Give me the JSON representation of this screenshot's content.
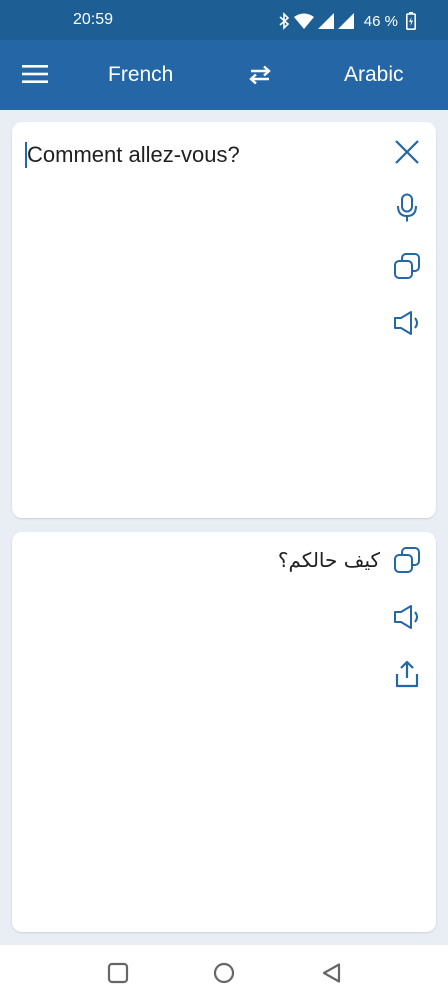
{
  "status_bar": {
    "time": "20:59",
    "battery": "46 %",
    "icons": [
      "bluetooth-icon",
      "wifi-icon",
      "signal-icon",
      "signal-icon",
      "battery-icon"
    ]
  },
  "app_bar": {
    "menu_icon": "menu-icon",
    "source_language": "French",
    "swap_icon": "swap-arrows-icon",
    "target_language": "Arabic"
  },
  "input_card": {
    "text": "Comment allez-vous?",
    "actions": [
      "close-icon",
      "microphone-icon",
      "copy-icon",
      "speaker-icon"
    ]
  },
  "output_card": {
    "text": "كيف حالكم؟",
    "actions": [
      "copy-icon",
      "speaker-icon",
      "share-icon"
    ]
  },
  "nav_bar": {
    "buttons": [
      "recents-square-icon",
      "home-circle-icon",
      "back-triangle-icon"
    ]
  },
  "colors": {
    "status_bar": "#1d5f95",
    "app_bar": "#2466a6",
    "accent": "#2466a6",
    "background": "#e9eef5"
  }
}
